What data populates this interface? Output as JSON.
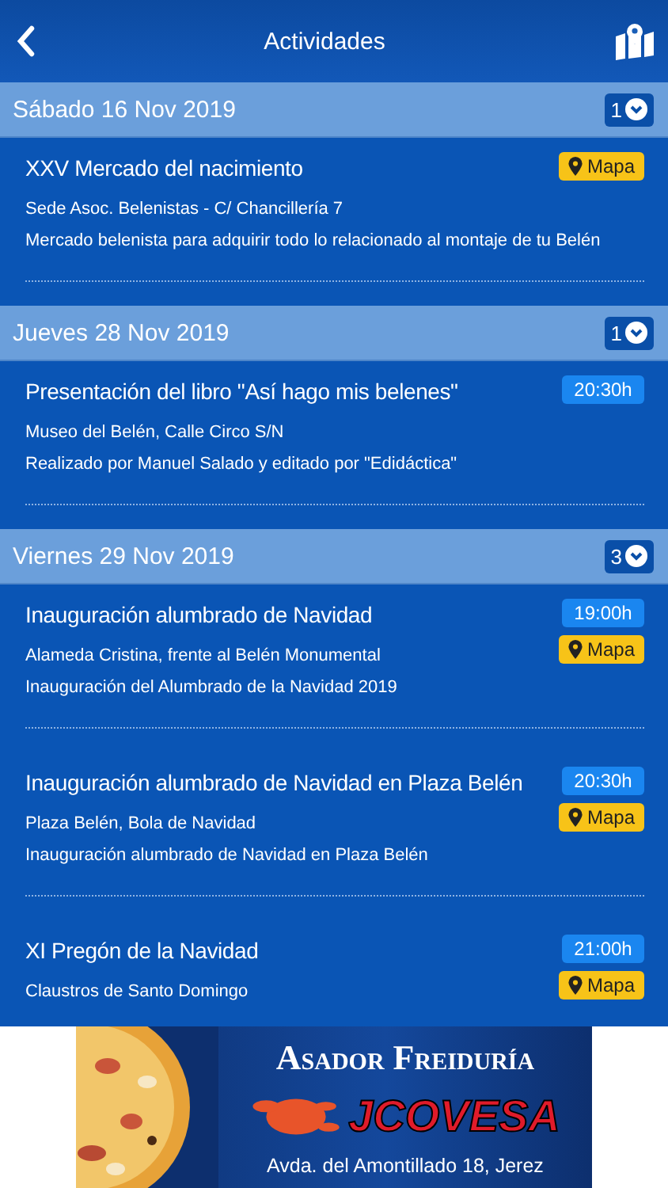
{
  "header": {
    "title": "Actividades"
  },
  "days": [
    {
      "date": "Sábado 16 Nov 2019",
      "count": "1",
      "expanded": true,
      "events": [
        {
          "title": "XXV Mercado del nacimiento",
          "location": "Sede Asoc. Belenistas - C/ Chancillería 7",
          "description": "Mercado belenista para adquirir todo lo relacionado al montaje de tu Belén",
          "map": "Mapa"
        }
      ]
    },
    {
      "date": "Jueves 28 Nov 2019",
      "count": "1",
      "expanded": true,
      "events": [
        {
          "title": "Presentación del libro \"Así hago mis belenes\"",
          "time": "20:30h",
          "location": "Museo del Belén, Calle Circo S/N",
          "description": "Realizado por Manuel Salado y editado por \"Edidáctica\""
        }
      ]
    },
    {
      "date": "Viernes 29 Nov 2019",
      "count": "3",
      "expanded": true,
      "events": [
        {
          "title": "Inauguración alumbrado de Navidad",
          "time": "19:00h",
          "map": "Mapa",
          "location": "Alameda Cristina, frente al Belén Monumental",
          "description": "Inauguración del Alumbrado de la Navidad 2019"
        },
        {
          "title": "Inauguración alumbrado de Navidad en Plaza Belén",
          "time": "20:30h",
          "map": "Mapa",
          "location": "Plaza Belén, Bola de Navidad",
          "description": "Inauguración alumbrado de Navidad en Plaza Belén"
        },
        {
          "title": "XI Pregón de la Navidad",
          "time": "21:00h",
          "map": "Mapa",
          "location": "Claustros de Santo Domingo"
        }
      ]
    }
  ],
  "ad": {
    "headline": "Asador Freiduría",
    "brand": "JCOVESA",
    "address": "Avda. del Amontillado 18, Jerez"
  }
}
